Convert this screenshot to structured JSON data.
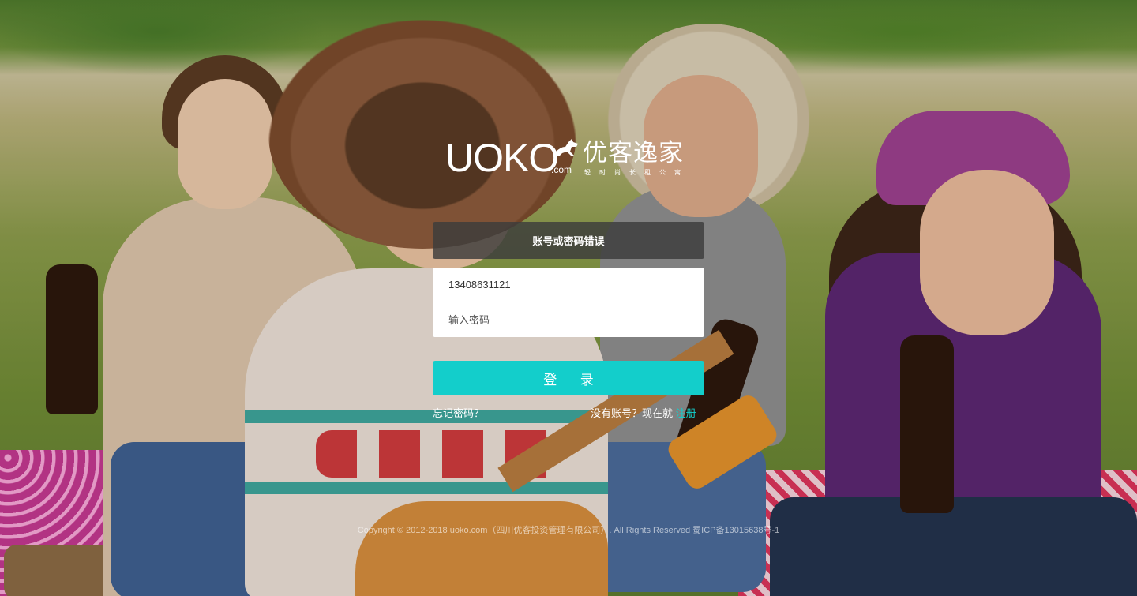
{
  "logo": {
    "brand_en": "UOKO",
    "dotcom": ".com",
    "brand_cn": "优客逸家",
    "slogan": "轻时尚长租公寓"
  },
  "login": {
    "error_message": "账号或密码错误",
    "account_value": "13408631121",
    "password_placeholder": "输入密码",
    "submit_label": "登 录",
    "forgot_label": "忘记密码？",
    "no_account_text": "没有账号？现在就 ",
    "register_label": "注册"
  },
  "footer": {
    "copyright": "Copyright © 2012-2018 uoko.com（四川优客投资管理有限公司）. All Rights Reserved 蜀ICP备13015638号-1"
  },
  "colors": {
    "accent": "#13cecb",
    "error_banner_bg": "#3c3c3c"
  }
}
